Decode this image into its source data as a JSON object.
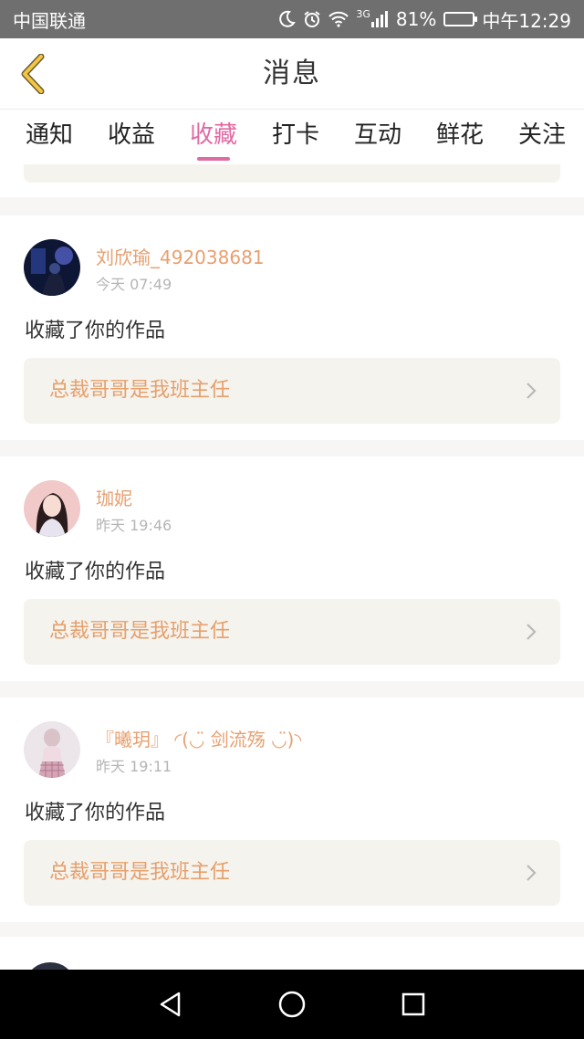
{
  "status_bar": {
    "carrier": "中国联通",
    "network": "3G",
    "battery_percent": "81%",
    "battery_level": 0.81,
    "time": "中午12:29",
    "icons": [
      "moon-icon",
      "alarm-icon",
      "wifi-icon",
      "signal-icon",
      "battery-icon"
    ]
  },
  "navbar": {
    "title": "消息",
    "back_icon": "chevron-left-icon"
  },
  "tabs": [
    {
      "label": "通知",
      "active": false
    },
    {
      "label": "收益",
      "active": false
    },
    {
      "label": "收藏",
      "active": true
    },
    {
      "label": "打卡",
      "active": false
    },
    {
      "label": "互动",
      "active": false
    },
    {
      "label": "鲜花",
      "active": false
    },
    {
      "label": "关注",
      "active": false
    }
  ],
  "messages": [
    {
      "username": "刘欣瑜_492038681",
      "time": "今天 07:49",
      "action": "收藏了你的作品",
      "work_title": "总裁哥哥是我班主任"
    },
    {
      "username": "珈妮",
      "time": "昨天 19:46",
      "action": "收藏了你的作品",
      "work_title": "总裁哥哥是我班主任"
    },
    {
      "username": "『曦玥』 ◜(◡̈ 剑流殇 ◡̈)◝",
      "time": "昨天 19:11",
      "action": "收藏了你的作品",
      "work_title": "总裁哥哥是我班主任"
    }
  ],
  "colors": {
    "accent_pink": "#e06aa3",
    "username_orange": "#e7a070",
    "work_card_bg": "#f5f3ee",
    "status_bar_bg": "#6f6f6f"
  },
  "system_nav": [
    "back-triangle-icon",
    "home-circle-icon",
    "recents-square-icon"
  ]
}
